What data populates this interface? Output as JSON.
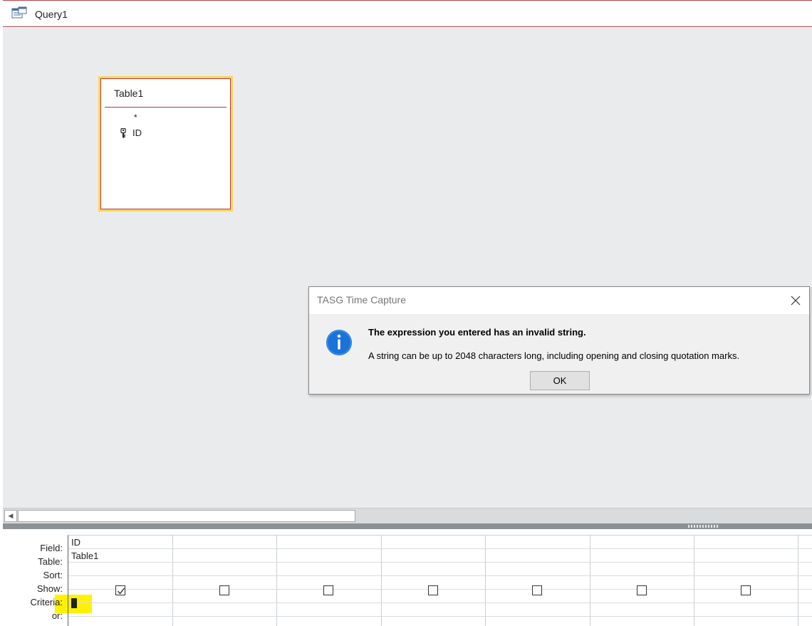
{
  "window": {
    "tab_title": "Query1",
    "tab_icon": "query-design-icon"
  },
  "table_box": {
    "title": "Table1",
    "fields": [
      {
        "label": "*",
        "icon": null
      },
      {
        "label": "ID",
        "icon": "primary-key-icon"
      }
    ]
  },
  "grid": {
    "row_labels": {
      "field": "Field:",
      "table": "Table:",
      "sort": "Sort:",
      "show": "Show:",
      "criteria": "Criteria:",
      "or": "or:"
    },
    "columns": [
      {
        "field": "ID",
        "table": "Table1",
        "sort": "",
        "show": true,
        "criteria": ""
      },
      {
        "field": "",
        "table": "",
        "sort": "",
        "show": false,
        "criteria": ""
      },
      {
        "field": "",
        "table": "",
        "sort": "",
        "show": false,
        "criteria": ""
      },
      {
        "field": "",
        "table": "",
        "sort": "",
        "show": false,
        "criteria": ""
      },
      {
        "field": "",
        "table": "",
        "sort": "",
        "show": false,
        "criteria": ""
      },
      {
        "field": "",
        "table": "",
        "sort": "",
        "show": false,
        "criteria": ""
      },
      {
        "field": "",
        "table": "",
        "sort": "",
        "show": false,
        "criteria": ""
      }
    ],
    "criteria_highlight_color": "#fff200"
  },
  "dialog": {
    "title": "TASG Time Capture",
    "heading": "The expression you entered has an invalid string.",
    "body": "A string can be up to 2048 characters long, including opening and closing quotation marks.",
    "ok_label": "OK",
    "icon": "info-icon",
    "close_icon": "close-icon"
  },
  "colors": {
    "accent_border": "#b03a42",
    "selection_border": "#fcd35a",
    "info_blue": "#1a73d9",
    "design_background": "#e9ebed"
  }
}
